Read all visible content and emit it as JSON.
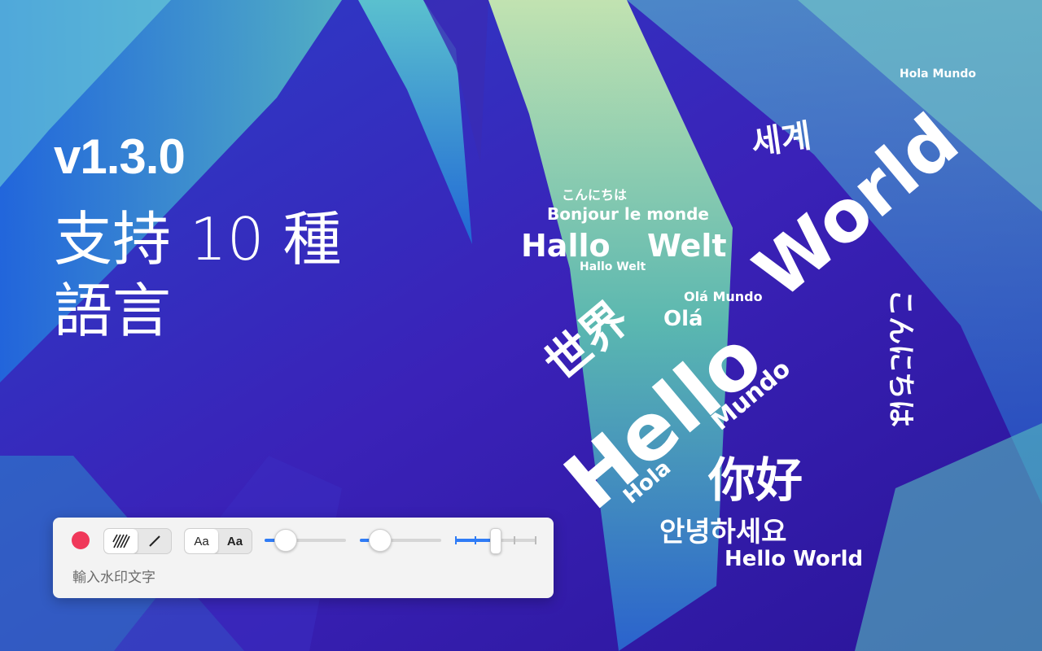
{
  "colors": {
    "accent_blue": "#2f7cf6",
    "record_red": "#f0385a",
    "panel_bg": "#f3f3f3",
    "bg_purple": "#3a1fb0",
    "bg_teal": "#4fb8b8",
    "bg_lime": "#b8e2a0"
  },
  "hero": {
    "version": "v1.3.0",
    "tagline_line1": "支持 10 種",
    "tagline_line2": "語言"
  },
  "wordcloud": {
    "words": [
      {
        "text": "Hello",
        "size": 96
      },
      {
        "text": "World",
        "size": 88
      },
      {
        "text": "你好",
        "size": 58
      },
      {
        "text": "世界",
        "size": 56
      },
      {
        "text": "세계",
        "size": 40
      },
      {
        "text": "Hallo",
        "size": 38
      },
      {
        "text": "Welt",
        "size": 38
      },
      {
        "text": "안녕하세요",
        "size": 34
      },
      {
        "text": "こんにちは",
        "size": 34
      },
      {
        "text": "Mundo",
        "size": 30
      },
      {
        "text": "Olá",
        "size": 26
      },
      {
        "text": "Hola",
        "size": 26
      },
      {
        "text": "Bonjour  le  monde",
        "size": 20
      },
      {
        "text": "Hello  World",
        "size": 26
      },
      {
        "text": "Hola  Mundo",
        "size": 14
      },
      {
        "text": "Hallo  Welt",
        "size": 14
      },
      {
        "text": "Olá  Mundo",
        "size": 16
      },
      {
        "text": "こんにちは",
        "size": 16
      }
    ]
  },
  "toolbar": {
    "record_icon": "record-dot-icon",
    "pattern_options": [
      {
        "icon": "hatch-pattern-icon",
        "selected": true
      },
      {
        "icon": "slash-line-icon",
        "selected": false
      }
    ],
    "font_options": [
      {
        "label": "Aa",
        "selected": true
      },
      {
        "label": "Aa",
        "selected": false
      }
    ],
    "opacity_level": 0.2,
    "size_level": 0.2,
    "density_level": 0.5,
    "input_placeholder": "輸入水印文字"
  }
}
